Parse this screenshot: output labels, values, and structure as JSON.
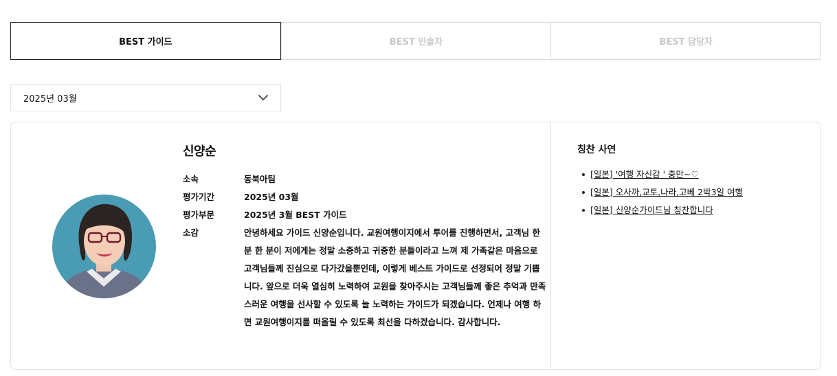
{
  "tabs": [
    {
      "label": "BEST 가이드",
      "active": true
    },
    {
      "label": "BEST 인솔자",
      "active": false
    },
    {
      "label": "BEST 담당자",
      "active": false
    }
  ],
  "month_select": {
    "selected": "2025년 03월",
    "icon": "chevron-down-icon"
  },
  "profile": {
    "name": "신양순",
    "photo_icon": "guide-portrait",
    "rows": [
      {
        "label": "소속",
        "value": "동북아팀"
      },
      {
        "label": "평가기간",
        "value": "2025년 03월"
      },
      {
        "label": "평가부문",
        "value": "2025년 3월 BEST 가이드"
      },
      {
        "label": "소감",
        "value": "안녕하세요 가이드 신양순입니다. 교원여행이지에서 투어를 진행하면서, 고객님 한 분 한 분이 저에게는 정말 소중하고 귀중한 분들이라고 느껴 제 가족같은 마음으로 고객님들께 진심으로 다가갔을뿐인데, 이렇게 베스트 가이드로 선정되어 정말 기쁩니다. 앞으로 더욱 열심히 노력하여 교원을 찾아주시는 고객님들께 좋은 추억과 만족스러운 여행을 선사할 수 있도록 늘 노력하는 가이드가 되겠습니다. 언제나 여행 하면 교원여행이지를 떠올릴 수 있도록 최선을 다하겠습니다. 감사합니다."
      }
    ]
  },
  "praise": {
    "title": "칭찬 사연",
    "items": [
      {
        "label": "[일본] '여행 자신감 ' 충만~♡"
      },
      {
        "label": "[일본] 오사까,교토,나라,고베 2박3일 여행"
      },
      {
        "label": "[일본] 신양순가이드님 칭찬합니다"
      }
    ]
  },
  "colors": {
    "border": "#e2e2e2",
    "active_tab_border": "#222222",
    "inactive_tab_text": "#c8c8c8",
    "avatar_background": "#4a9cb5"
  }
}
